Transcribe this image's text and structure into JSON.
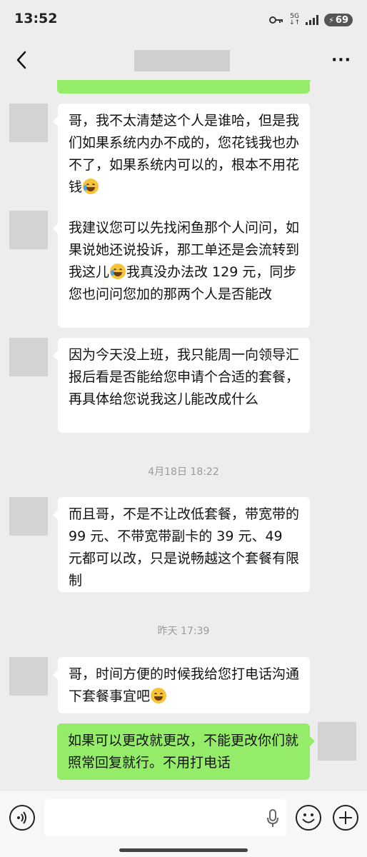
{
  "status_bar": {
    "time": "13:52",
    "network": "5G",
    "battery": "69"
  },
  "nav": {
    "title": ""
  },
  "messages": [
    {
      "side": "right",
      "text": ""
    },
    {
      "side": "left",
      "text": "哥，我不太清楚这个人是谁哈，但是我们如果系统内办不成的，您花钱我也办不了，如果系统内可以的，根本不用花钱",
      "emoji": "cry"
    },
    {
      "side": "left",
      "text_before": "我建议您可以先找闲鱼那个人问问，如果说她还说投诉，那工单还是会流转到我这儿",
      "emoji": "cry",
      "text_after": "我真没办法改 129 元，同步您也问问您加的那两个人是否能改"
    },
    {
      "side": "left",
      "text": "因为今天没上班，我只能周一向领导汇报后看是否能给您申请个合适的套餐，再具体给您说我这儿能改成什么"
    },
    {
      "timestamp": "4月18日 18:22"
    },
    {
      "side": "left",
      "text": "而且哥，不是不让改低套餐，带宽带的 99 元、不带宽带副卡的 39 元、49 元都可以改，只是说畅越这个套餐有限制"
    },
    {
      "timestamp": "昨天 17:39"
    },
    {
      "side": "left",
      "text": "哥，时间方便的时候我给您打电话沟通下套餐事宜吧",
      "emoji": "grin"
    },
    {
      "side": "right",
      "text": "如果可以更改就更改，不能更改你们就照常回复就行。不用打电话"
    }
  ],
  "colors": {
    "background": "#ededed",
    "bubble_left": "#ffffff",
    "bubble_right": "#95ec69",
    "avatar_placeholder": "#d3d3d3",
    "timestamp": "#9a9a9a"
  },
  "icons": {
    "back": "chevron-left-icon",
    "more": "more-dots-icon",
    "voice": "voice-icon",
    "mic": "mic-icon",
    "emoji": "emoji-icon",
    "plus": "plus-icon",
    "key": "key-icon",
    "signal": "signal-icon"
  }
}
